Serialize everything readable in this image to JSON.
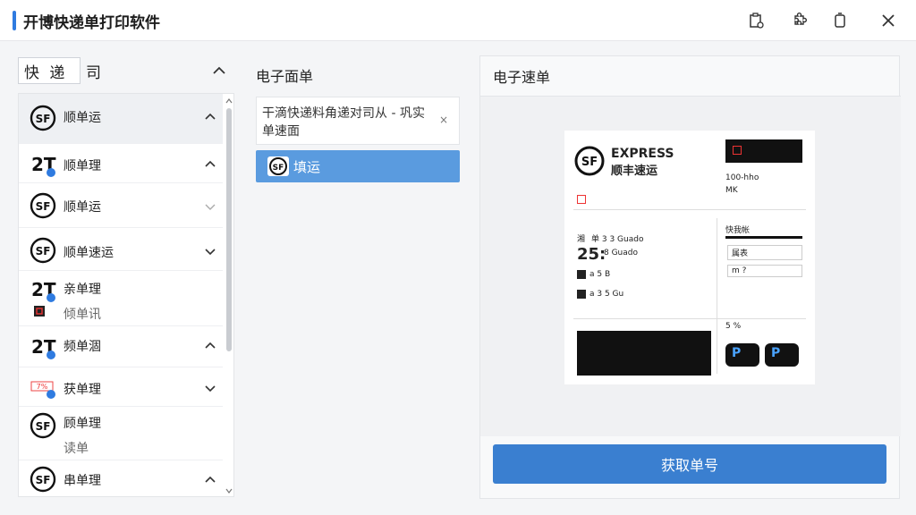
{
  "window": {
    "title": "开博快递单打印软件"
  },
  "left": {
    "search_value": "快 递",
    "search_suffix": "司",
    "items": [
      {
        "label": "顺单运",
        "sub": "",
        "logo": "SF"
      },
      {
        "label": "顺单理",
        "sub": "",
        "logo": "ZT"
      },
      {
        "label": "顺单运",
        "sub": "",
        "logo": "SF"
      },
      {
        "label": "顺单速运",
        "sub": "",
        "logo": "SF"
      },
      {
        "label": "亲单理",
        "sub": "倾单讯",
        "logo": "ZT"
      },
      {
        "label": "频单涸",
        "sub": "",
        "logo": "ZT"
      },
      {
        "label": "获单理",
        "sub": "",
        "logo": "RED"
      },
      {
        "label": "顾单理",
        "sub": "读单",
        "logo": "SF"
      },
      {
        "label": "串单理",
        "sub": "",
        "logo": "SF"
      }
    ]
  },
  "middle": {
    "title": "电子面单",
    "card_text": "干滴快递料角递对司从 - 巩实单速面",
    "card_close": "×",
    "selected_label": "填运"
  },
  "right": {
    "title": "电子速单",
    "waybill": {
      "brand": "EXPRESS",
      "brand_cn": "顺丰速运",
      "logo": "SF",
      "top_right_a": "100-hho",
      "top_right_b": "MK",
      "mid_left_code": "湘",
      "mid_left_l1": "单 3 3 Guado",
      "mid_left_big": "25:",
      "mid_left_l2": "8 Guado",
      "row_a": "a 5 B",
      "row_b": "5 %",
      "row_c": "a 3 5 Gu",
      "right_head": "快我帐",
      "right_row1": "属表",
      "right_row2": "m ?"
    },
    "action_button": "获取单号"
  }
}
